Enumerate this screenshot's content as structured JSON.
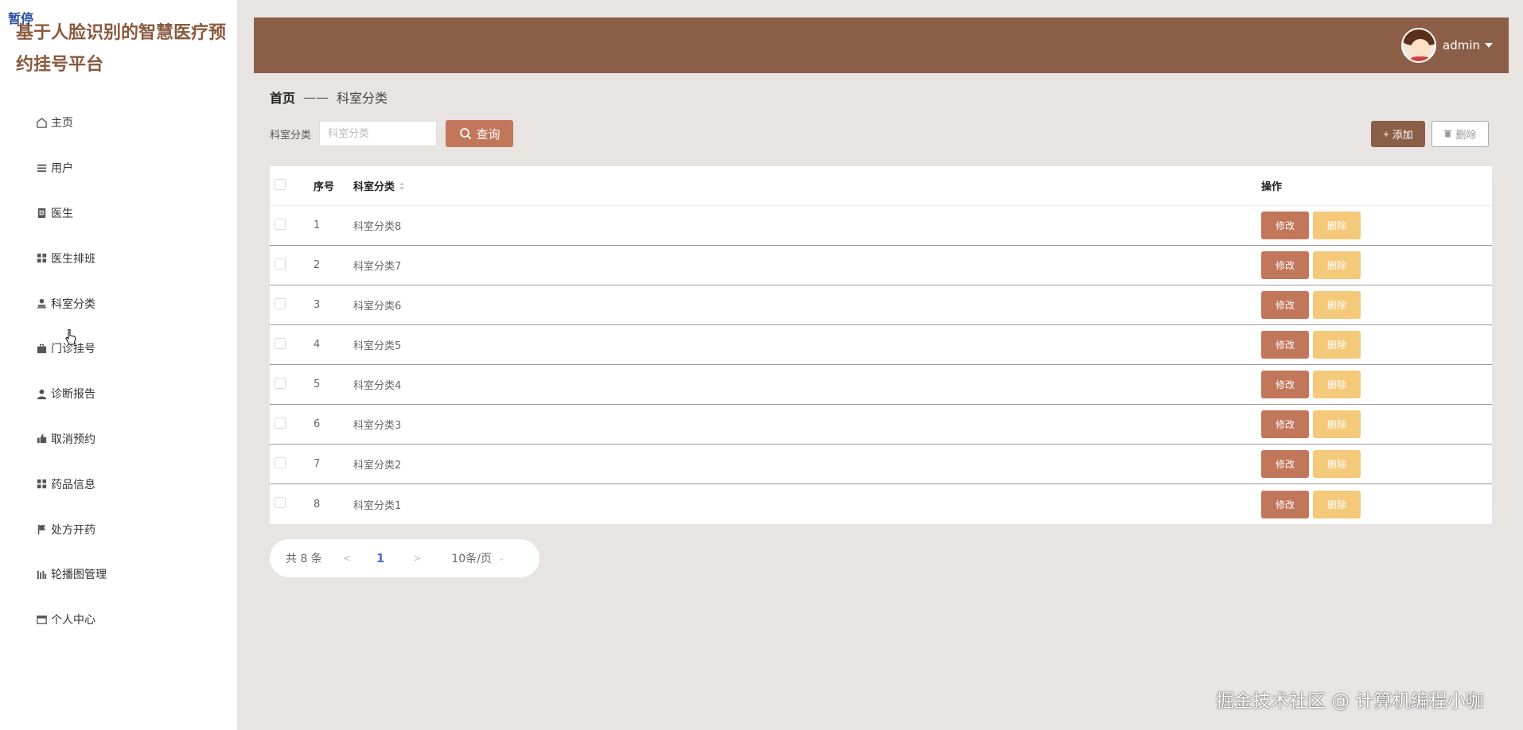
{
  "overlay": {
    "pause_label": "暂停"
  },
  "sidebar": {
    "brand": "基于人脸识别的智慧医疗预约挂号平台",
    "items": [
      {
        "label": "主页",
        "icon": "home-icon"
      },
      {
        "label": "用户",
        "icon": "list-icon"
      },
      {
        "label": "医生",
        "icon": "clipboard-icon"
      },
      {
        "label": "医生排班",
        "icon": "grid-icon"
      },
      {
        "label": "科室分类",
        "icon": "person-icon"
      },
      {
        "label": "门诊挂号",
        "icon": "briefcase-icon"
      },
      {
        "label": "诊断报告",
        "icon": "user-icon"
      },
      {
        "label": "取消预约",
        "icon": "thumb-icon"
      },
      {
        "label": "药品信息",
        "icon": "grid-icon"
      },
      {
        "label": "处方开药",
        "icon": "flag-icon"
      },
      {
        "label": "轮播图管理",
        "icon": "chart-icon"
      },
      {
        "label": "个人中心",
        "icon": "window-icon"
      }
    ]
  },
  "header": {
    "username": "admin"
  },
  "breadcrumb": {
    "home": "首页",
    "separator": "——",
    "current": "科室分类"
  },
  "search": {
    "label": "科室分类",
    "placeholder": "科室分类",
    "query_button": "查询"
  },
  "toolbar": {
    "add_label": "添加",
    "delete_label": "删除"
  },
  "table": {
    "headers": {
      "index": "序号",
      "name": "科室分类",
      "actions": "操作"
    },
    "rows": [
      {
        "index": "1",
        "name": "科室分类8"
      },
      {
        "index": "2",
        "name": "科室分类7"
      },
      {
        "index": "3",
        "name": "科室分类6"
      },
      {
        "index": "4",
        "name": "科室分类5"
      },
      {
        "index": "5",
        "name": "科室分类4"
      },
      {
        "index": "6",
        "name": "科室分类3"
      },
      {
        "index": "7",
        "name": "科室分类2"
      },
      {
        "index": "8",
        "name": "科室分类1"
      }
    ],
    "edit_label": "修改",
    "delete_label": "删除"
  },
  "pagination": {
    "total": "共 8 条",
    "prev": "<",
    "current_page": "1",
    "next": ">",
    "page_size": "10条/页"
  },
  "watermark": "掘金技术社区 @ 计算机编程小咖",
  "colors": {
    "header_bg": "#8b5e47",
    "primary_button": "#c2765a",
    "danger_button": "#f5c97a",
    "brand_text": "#8a5a3e"
  }
}
